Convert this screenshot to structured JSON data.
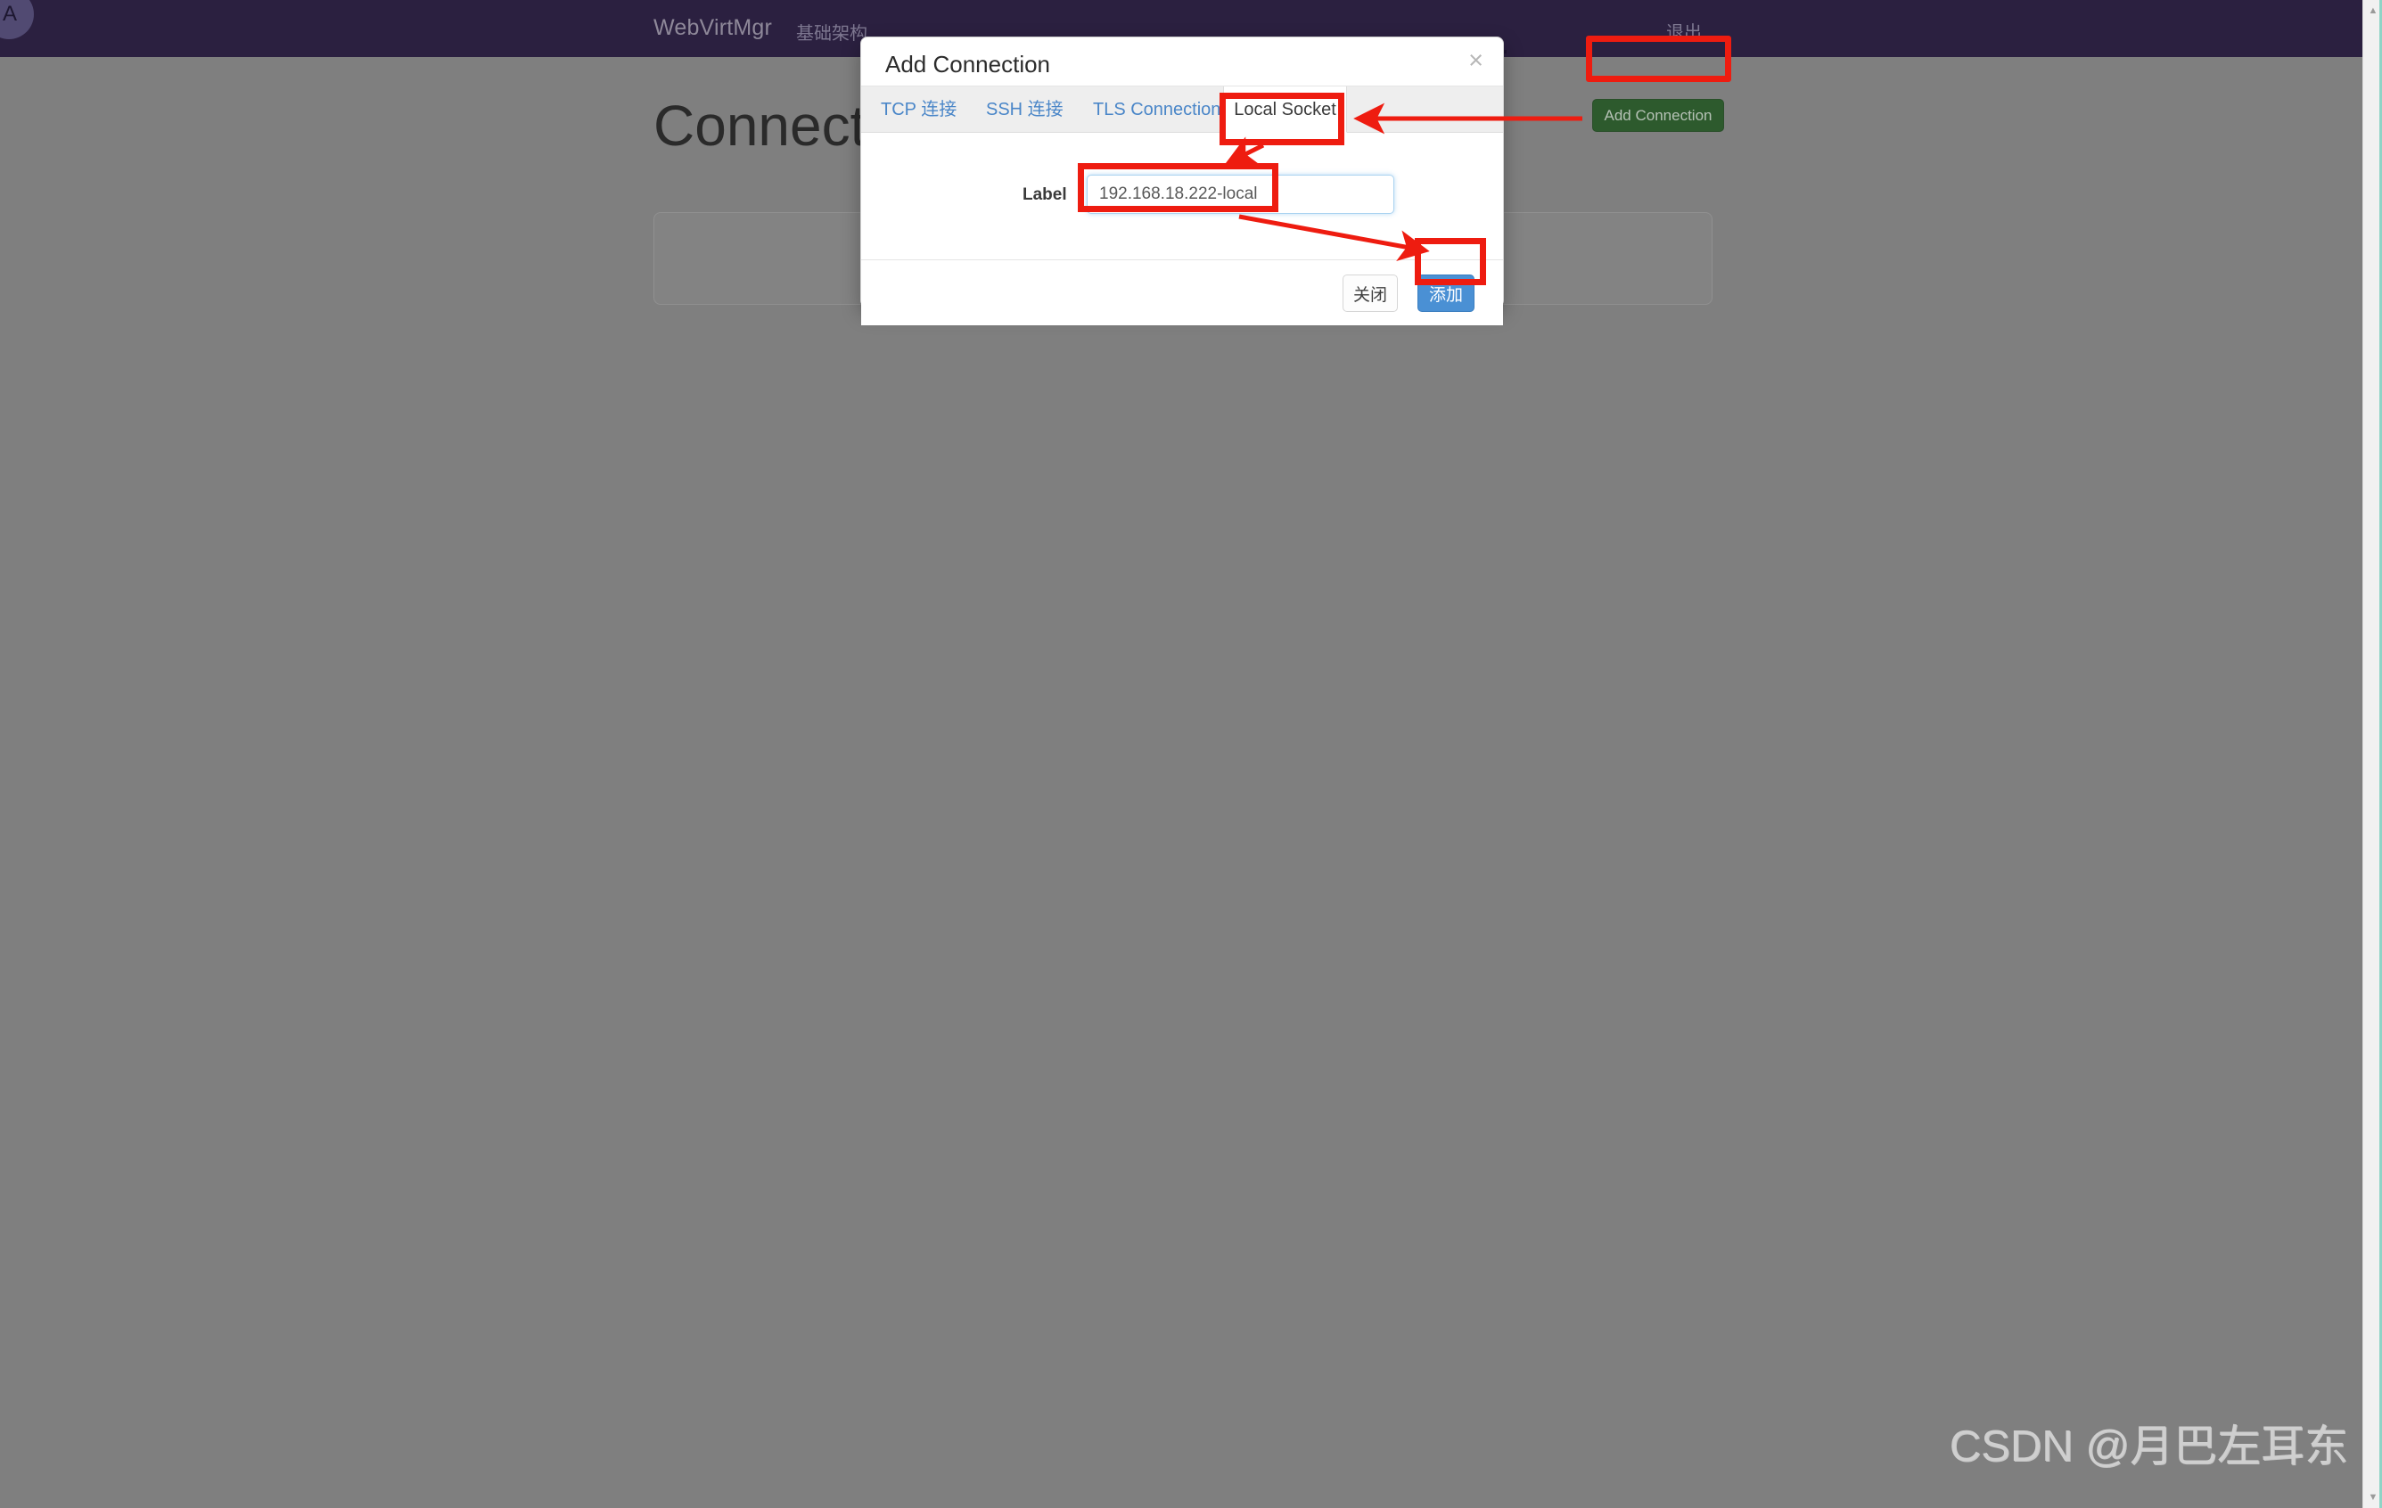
{
  "navbar": {
    "avatar_initials": "A",
    "brand": "WebVirtMgr",
    "infrastructure_link": "基础架构",
    "logout_link": "退出"
  },
  "page": {
    "title": "Connections",
    "add_connection_button": "Add Connection"
  },
  "modal": {
    "title": "Add Connection",
    "close_icon": "×",
    "tabs": [
      {
        "label": "TCP 连接",
        "active": false
      },
      {
        "label": "SSH 连接",
        "active": false
      },
      {
        "label": "TLS Connection",
        "active": false
      },
      {
        "label": "Local Socket",
        "active": true
      }
    ],
    "form": {
      "label_text": "Label",
      "label_value": "192.168.18.222-local",
      "label_placeholder": ""
    },
    "footer": {
      "close_button": "关闭",
      "submit_button": "添加"
    }
  },
  "annotations": {
    "highlight_color": "#ee1c10",
    "boxes": [
      "add-connection-button",
      "local-socket-tab",
      "label-input",
      "submit-button"
    ],
    "arrows": [
      "add-connection-to-local-socket",
      "local-socket-to-label-input",
      "label-input-to-submit-button"
    ]
  },
  "watermark": "CSDN @月巴左耳东",
  "scrollbar": {
    "up_arrow": "▲",
    "down_arrow": "▼"
  },
  "colors": {
    "navbar_bg": "#2b2040",
    "backdrop": "#7f7f7f",
    "tab_link": "#4a86c8",
    "primary_button": "#4a90d4",
    "success_button": "#2d5a2d",
    "annotation_red": "#ee1c10"
  }
}
